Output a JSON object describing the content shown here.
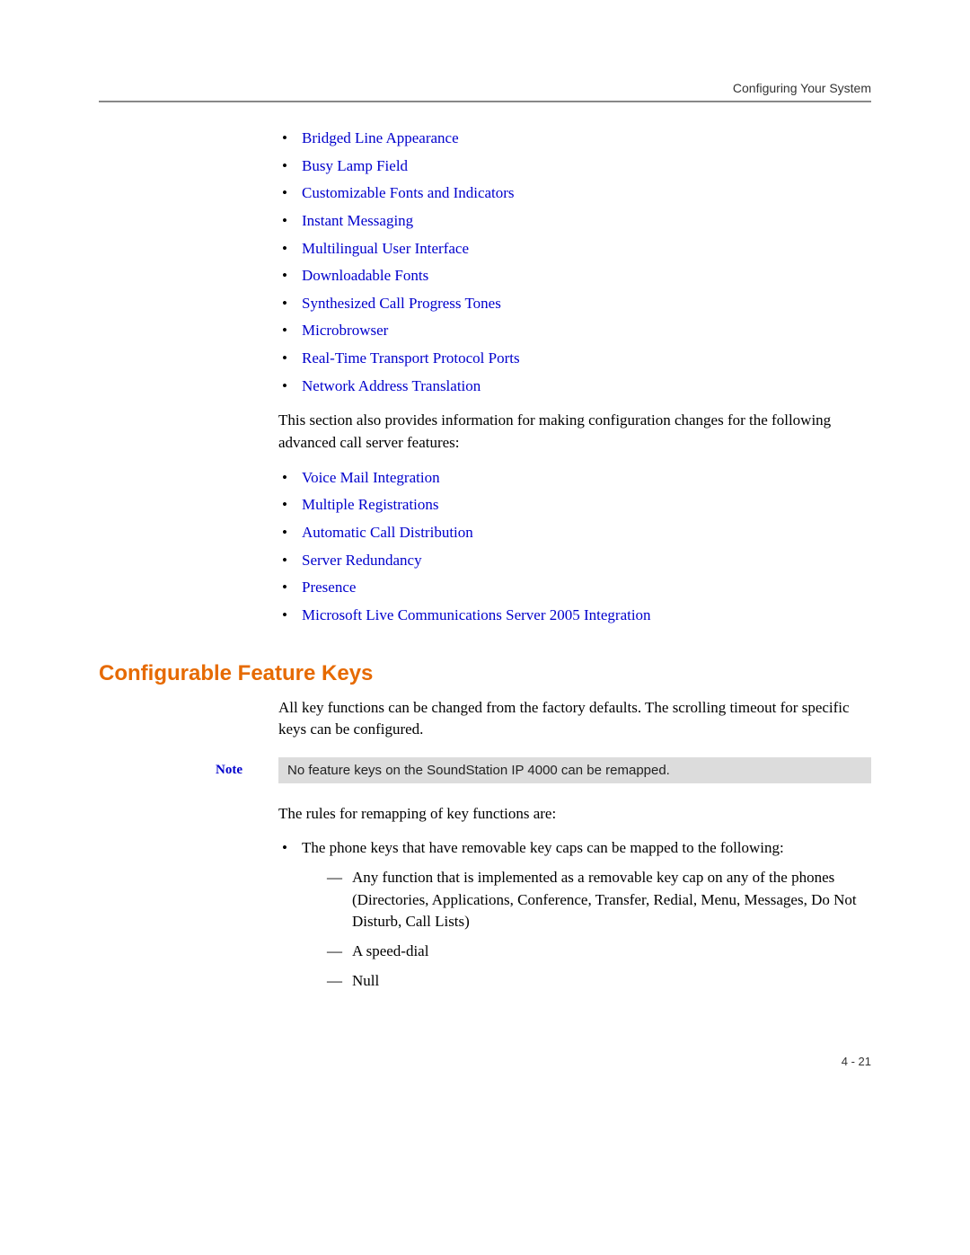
{
  "header": {
    "running_head": "Configuring Your System"
  },
  "links_top": [
    "Bridged Line Appearance",
    "Busy Lamp Field",
    "Customizable Fonts and Indicators",
    "Instant Messaging",
    "Multilingual User Interface",
    "Downloadable Fonts",
    "Synthesized Call Progress Tones",
    "Microbrowser",
    "Real-Time Transport Protocol Ports",
    "Network Address Translation"
  ],
  "intro_para": "This section also provides information for making configuration changes for the following advanced call server features:",
  "links_advanced": [
    "Voice Mail Integration",
    "Multiple Registrations",
    "Automatic Call Distribution",
    "Server Redundancy",
    "Presence",
    "Microsoft Live Communications Server 2005 Integration"
  ],
  "section": {
    "heading": "Configurable Feature Keys",
    "para1": "All key functions can be changed from the factory defaults. The scrolling timeout for specific keys can be configured.",
    "note_label": "Note",
    "note_text": "No feature keys on the SoundStation IP 4000 can be remapped.",
    "para2": "The rules for remapping of key functions are:",
    "bullet_intro": "The phone keys that have removable key caps can be mapped to the following:",
    "sub_bullets": [
      "Any function that is implemented as a removable key cap on any of the phones (Directories, Applications, Conference, Transfer, Redial, Menu, Messages, Do Not Disturb, Call Lists)",
      "A speed-dial",
      "Null"
    ]
  },
  "footer": {
    "page_number": "4 - 21"
  }
}
